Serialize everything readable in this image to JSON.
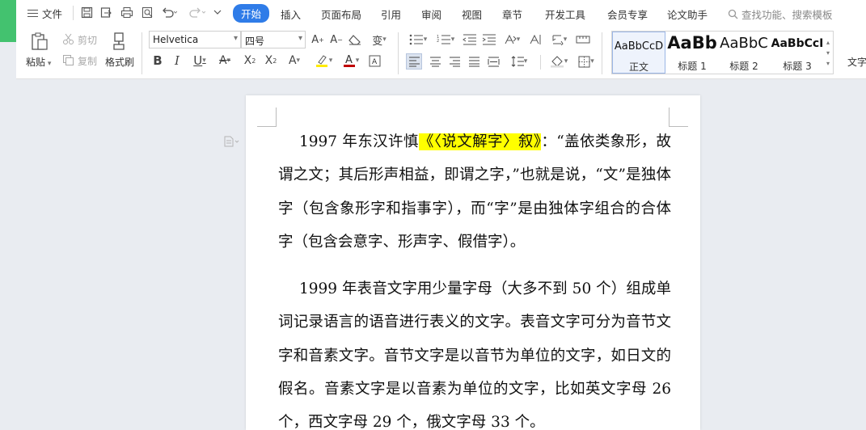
{
  "menubar": {
    "file_label": "文件",
    "tabs": [
      "开始",
      "插入",
      "页面布局",
      "引用",
      "审阅",
      "视图",
      "章节",
      "开发工具",
      "会员专享",
      "论文助手"
    ],
    "search_placeholder": "查找功能、搜索模板"
  },
  "ribbon": {
    "paste": "粘贴",
    "cut": "剪切",
    "copy": "复制",
    "format_painter": "格式刷",
    "font_name": "Helvetica",
    "font_size": "四号",
    "styles": [
      {
        "sample": "AaBbCcD",
        "name": "正文"
      },
      {
        "sample": "AaBb",
        "name": "标题 1"
      },
      {
        "sample": "AaBbC",
        "name": "标题 2"
      },
      {
        "sample": "AaBbCcI",
        "name": "标题 3"
      }
    ],
    "text_tool": "文字"
  },
  "document": {
    "p1_before": "1997 年东汉许慎",
    "p1_highlight": "《〈说文解字〉叙》",
    "p1_after": "：“盖依类象形，故谓之文；其后形声相益，即谓之字，”也就是说，“文”是独体字（包含象形字和指事字），而“字”是由独体字组合的合体字（包含会意字、形声字、假借字）。",
    "p2": "1999 年表音文字用少量字母（大多不到 50 个）组成单词记录语言的语音进行表义的文字。表音文字可分为音节文字和音素文字。音节文字是以音节为单位的文字，如日文的假名。音素文字是以音素为单位的文字，比如英文字母 26 个，西文字母 29 个，俄文字母 33 个。"
  }
}
